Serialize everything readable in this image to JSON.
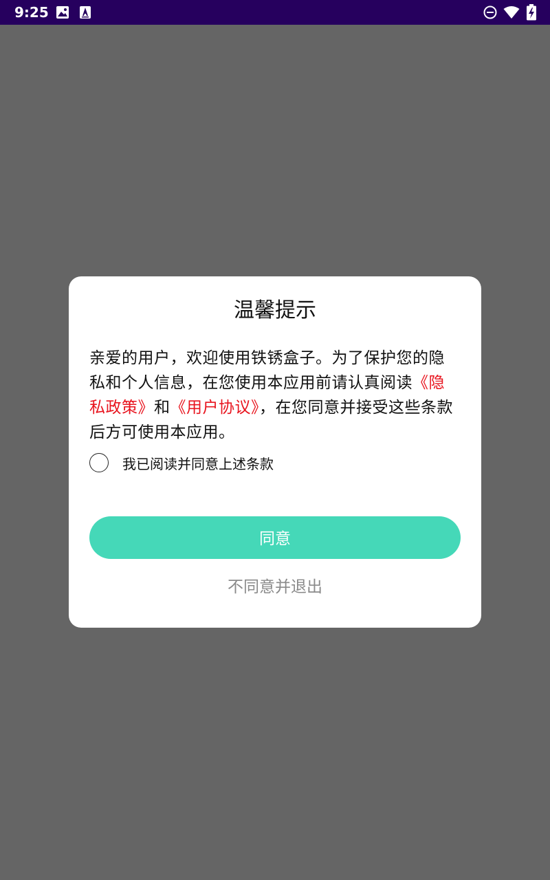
{
  "status_bar": {
    "time": "9:25",
    "left_icons": [
      "image-icon",
      "text-a-icon"
    ],
    "right_icons": [
      "do-not-disturb-icon",
      "wifi-icon",
      "battery-charging-icon"
    ],
    "background": "#26005e"
  },
  "dialog": {
    "title": "温馨提示",
    "body": {
      "part1": "亲爱的用户，欢迎使用铁锈盒子。为了保护您的隐私和个人信息，在您使用本应用前请认真阅读",
      "privacy_link": "《隐私政策》",
      "joiner": "和",
      "agreement_link": "《用户协议》",
      "part2": "，在您同意并接受这些条款后方可使用本应用。"
    },
    "checkbox_label": "我已阅读并同意上述条款",
    "checkbox_checked": false,
    "agree_button": "同意",
    "decline_button": "不同意并退出",
    "colors": {
      "accent": "#45d8b8",
      "link": "#e8141e",
      "decline_text": "#8a8a8a",
      "overlay": "#656565"
    }
  }
}
